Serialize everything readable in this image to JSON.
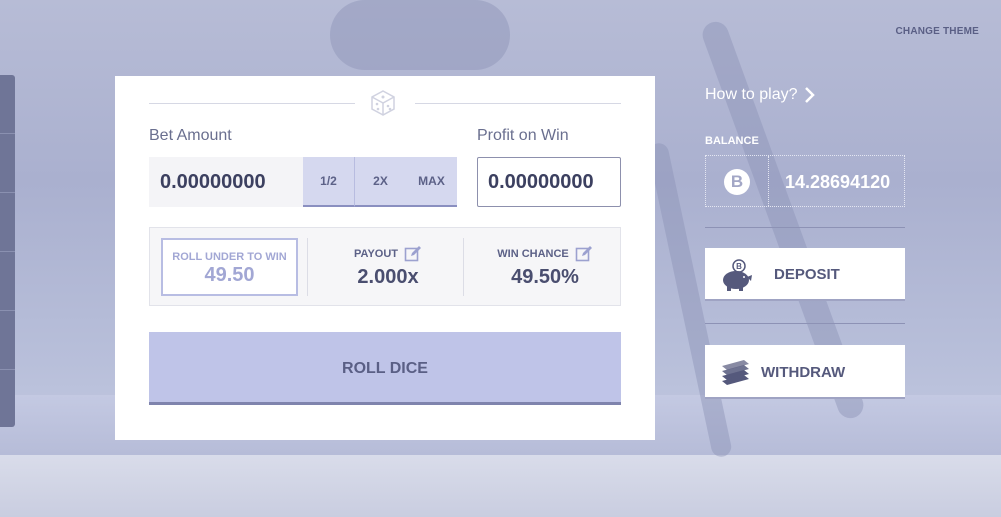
{
  "header": {
    "change_theme": "CHANGE THEME"
  },
  "bet": {
    "amount_label": "Bet Amount",
    "amount_value": "0.00000000",
    "half_label": "1/2",
    "double_label": "2X",
    "max_label": "MAX",
    "profit_label": "Profit on Win",
    "profit_value": "0.00000000"
  },
  "stats": {
    "roll_under_label": "ROLL UNDER TO WIN",
    "roll_under_value": "49.50",
    "payout_label": "PAYOUT",
    "payout_value": "2.000x",
    "win_chance_label": "WIN CHANCE",
    "win_chance_value": "49.50%"
  },
  "roll_button": "ROLL DICE",
  "sidebar": {
    "how_to_play": "How to play?",
    "balance_label": "BALANCE",
    "balance_currency_symbol": "B",
    "balance_value": "14.28694120",
    "deposit_label": "DEPOSIT",
    "withdraw_label": "WITHDRAW"
  },
  "icons": {
    "dice": "dice-icon",
    "edit": "edit-icon",
    "bitcoin": "bitcoin-icon",
    "piggy_bank": "piggy-bank-icon",
    "cash_stack": "cash-stack-icon",
    "chevron_right": "chevron-right-icon"
  },
  "colors": {
    "accent": "#bfc4e8",
    "text_dark": "#4a4e6f",
    "muted": "#a2a7d4"
  }
}
